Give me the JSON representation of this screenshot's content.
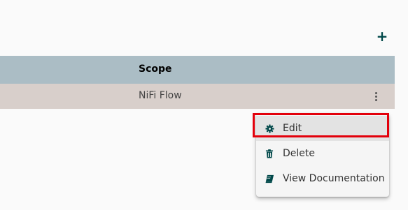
{
  "toolbar": {
    "add_icon": "plus-icon",
    "add_label": "+"
  },
  "table": {
    "columns": [
      "Scope"
    ],
    "rows": [
      {
        "scope": "NiFi Flow",
        "menu_icon": "more-vert-icon"
      }
    ]
  },
  "context_menu": {
    "items": [
      {
        "label": "Edit",
        "icon": "gear-icon",
        "highlighted": true
      },
      {
        "label": "Delete",
        "icon": "trash-icon",
        "highlighted": false
      },
      {
        "label": "View Documentation",
        "icon": "book-icon",
        "highlighted": false
      }
    ]
  },
  "colors": {
    "accent": "#004849",
    "header_bg": "#abbdc5",
    "row_bg": "#d8cfcb",
    "highlight_border": "#e3000b"
  }
}
